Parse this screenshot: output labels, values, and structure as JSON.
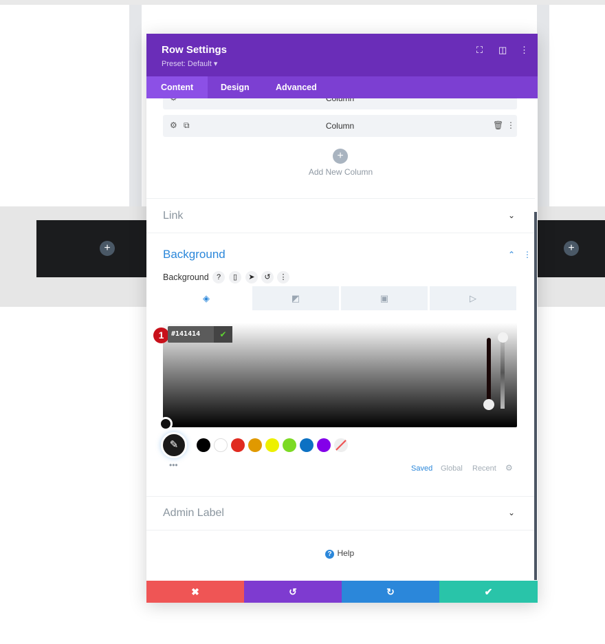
{
  "modal": {
    "title": "Row Settings",
    "preset": "Preset: Default ▾",
    "tabs": [
      "Content",
      "Design",
      "Advanced"
    ],
    "columns": [
      "Column",
      "Column"
    ],
    "add_column": "Add New Column",
    "sections": {
      "link": "Link",
      "background": "Background",
      "admin_label": "Admin Label"
    },
    "background_label": "Background",
    "hex_value": "#141414",
    "step_badge": "1",
    "swatches": [
      "#000000",
      "#ffffff",
      "#e02b20",
      "#e09900",
      "#edf000",
      "#7cda24",
      "#0c71c3",
      "#8300e9"
    ],
    "palette_tabs": [
      "Saved",
      "Global",
      "Recent"
    ],
    "help": "Help",
    "footer_colors": {
      "cancel": "#ef5555",
      "undo": "#7e3bd0",
      "redo": "#2b87da",
      "save": "#29c4a9"
    }
  },
  "colors": {
    "header": "#6a2db8",
    "tabs": "#7c3fd2",
    "accent": "#2b87da"
  }
}
